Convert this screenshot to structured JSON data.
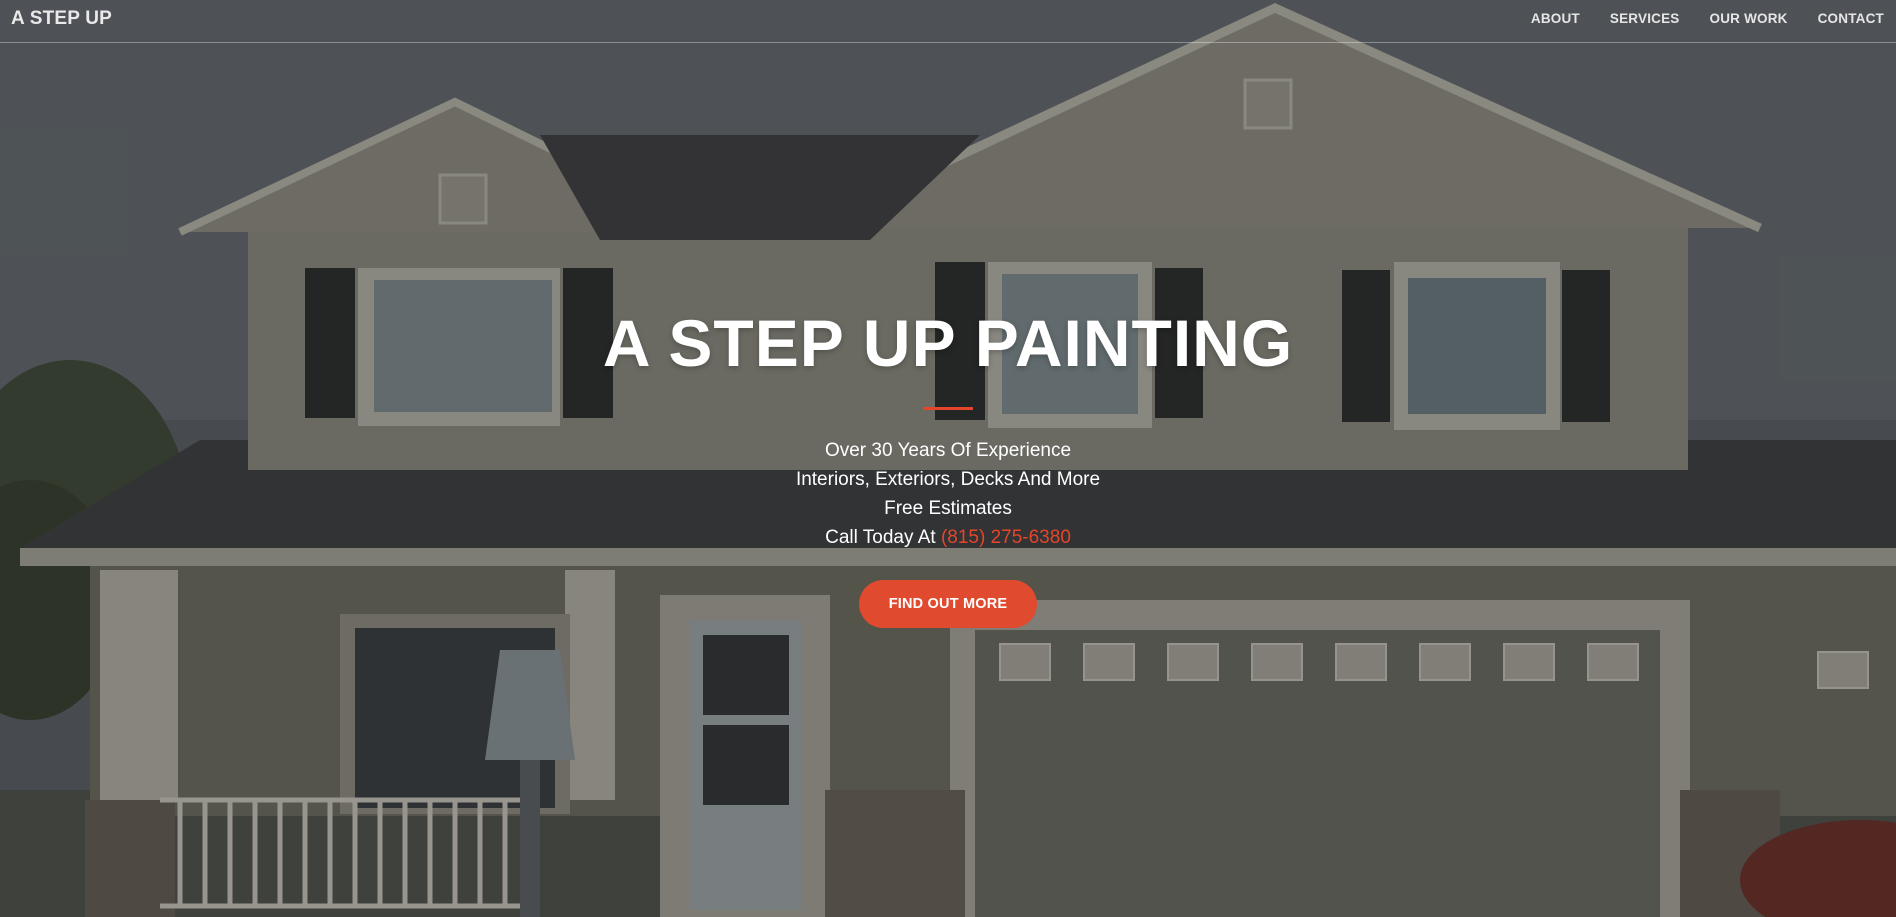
{
  "navbar": {
    "brand": "A STEP UP",
    "links": [
      "ABOUT",
      "SERVICES",
      "OUR WORK",
      "CONTACT"
    ]
  },
  "hero": {
    "title": "A STEP UP PAINTING",
    "lines": [
      "Over 30 Years Of Experience",
      "Interiors, Exteriors, Decks And More",
      "Free Estimates"
    ],
    "call_prefix": "Call Today At",
    "phone": "(815) 275-6380",
    "cta_label": "FIND OUT MORE",
    "background_image": "house-photo"
  },
  "colors": {
    "accent": "#e04a2f",
    "text": "#ffffff"
  }
}
